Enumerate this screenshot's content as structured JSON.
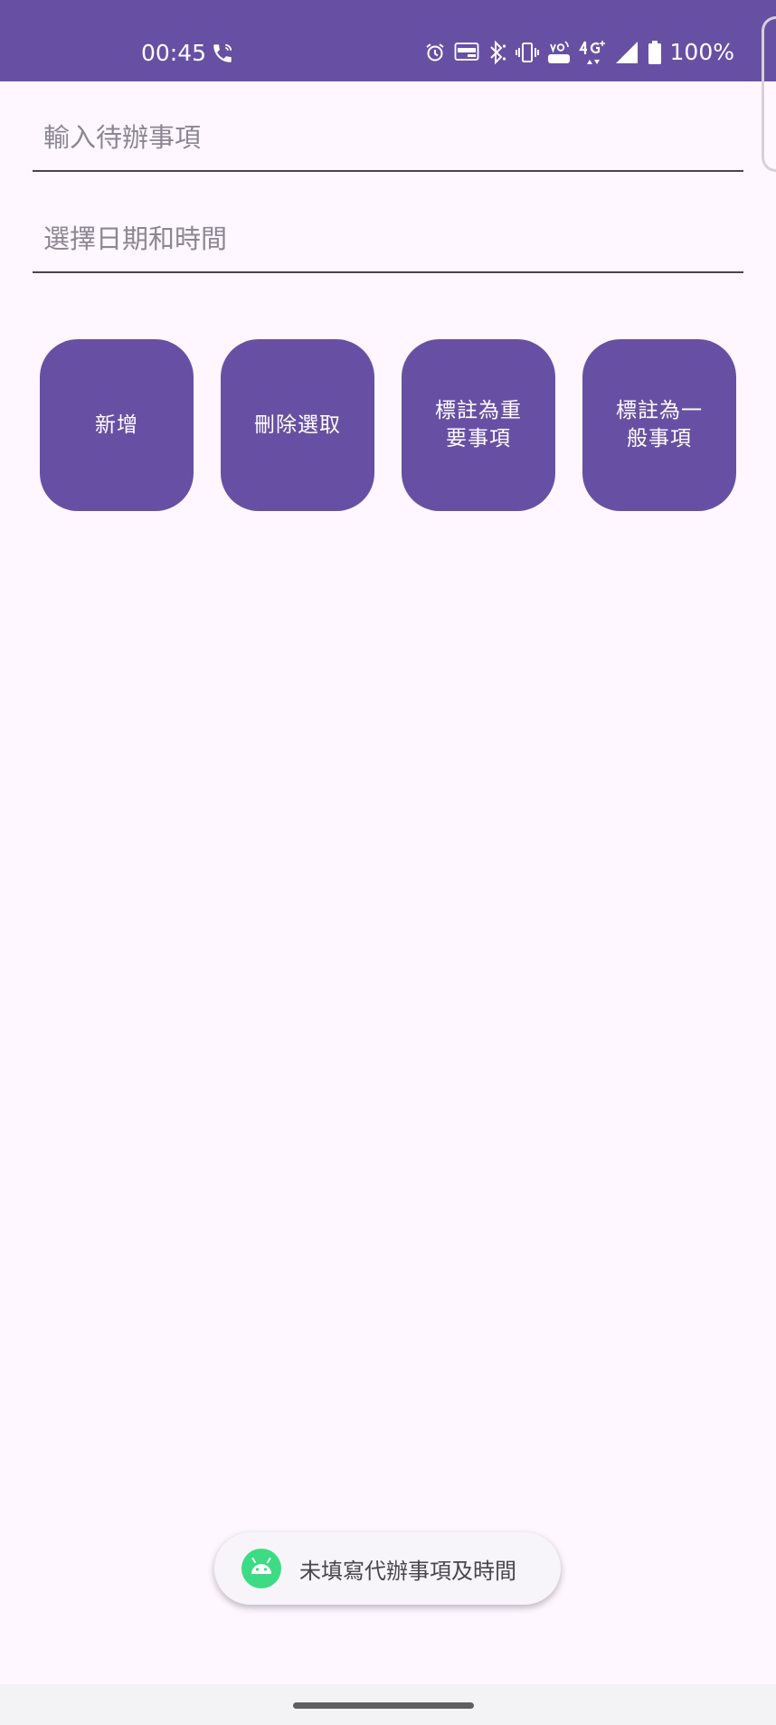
{
  "status_bar": {
    "time": "00:45",
    "battery_text": "100%",
    "icons": [
      "call-icon",
      "alarm-icon",
      "auto-hd-icon",
      "bluetooth-icon",
      "vibrate-icon",
      "volte-icon",
      "4g-icon",
      "signal-icon",
      "battery-icon"
    ]
  },
  "form": {
    "todo_placeholder": "輸入待辦事項",
    "todo_value": "",
    "datetime_placeholder": "選擇日期和時間",
    "datetime_value": ""
  },
  "buttons": {
    "add": "新增",
    "delete_selected": "刪除選取",
    "mark_important": "標註為重要事項",
    "mark_normal": "標註為一般事項"
  },
  "toast": {
    "message": "未填寫代辦事項及時間",
    "icon": "android-icon"
  },
  "colors": {
    "primary": "#6750A4",
    "background": "#FEF7FF",
    "toast_icon": "#3DDC84"
  }
}
